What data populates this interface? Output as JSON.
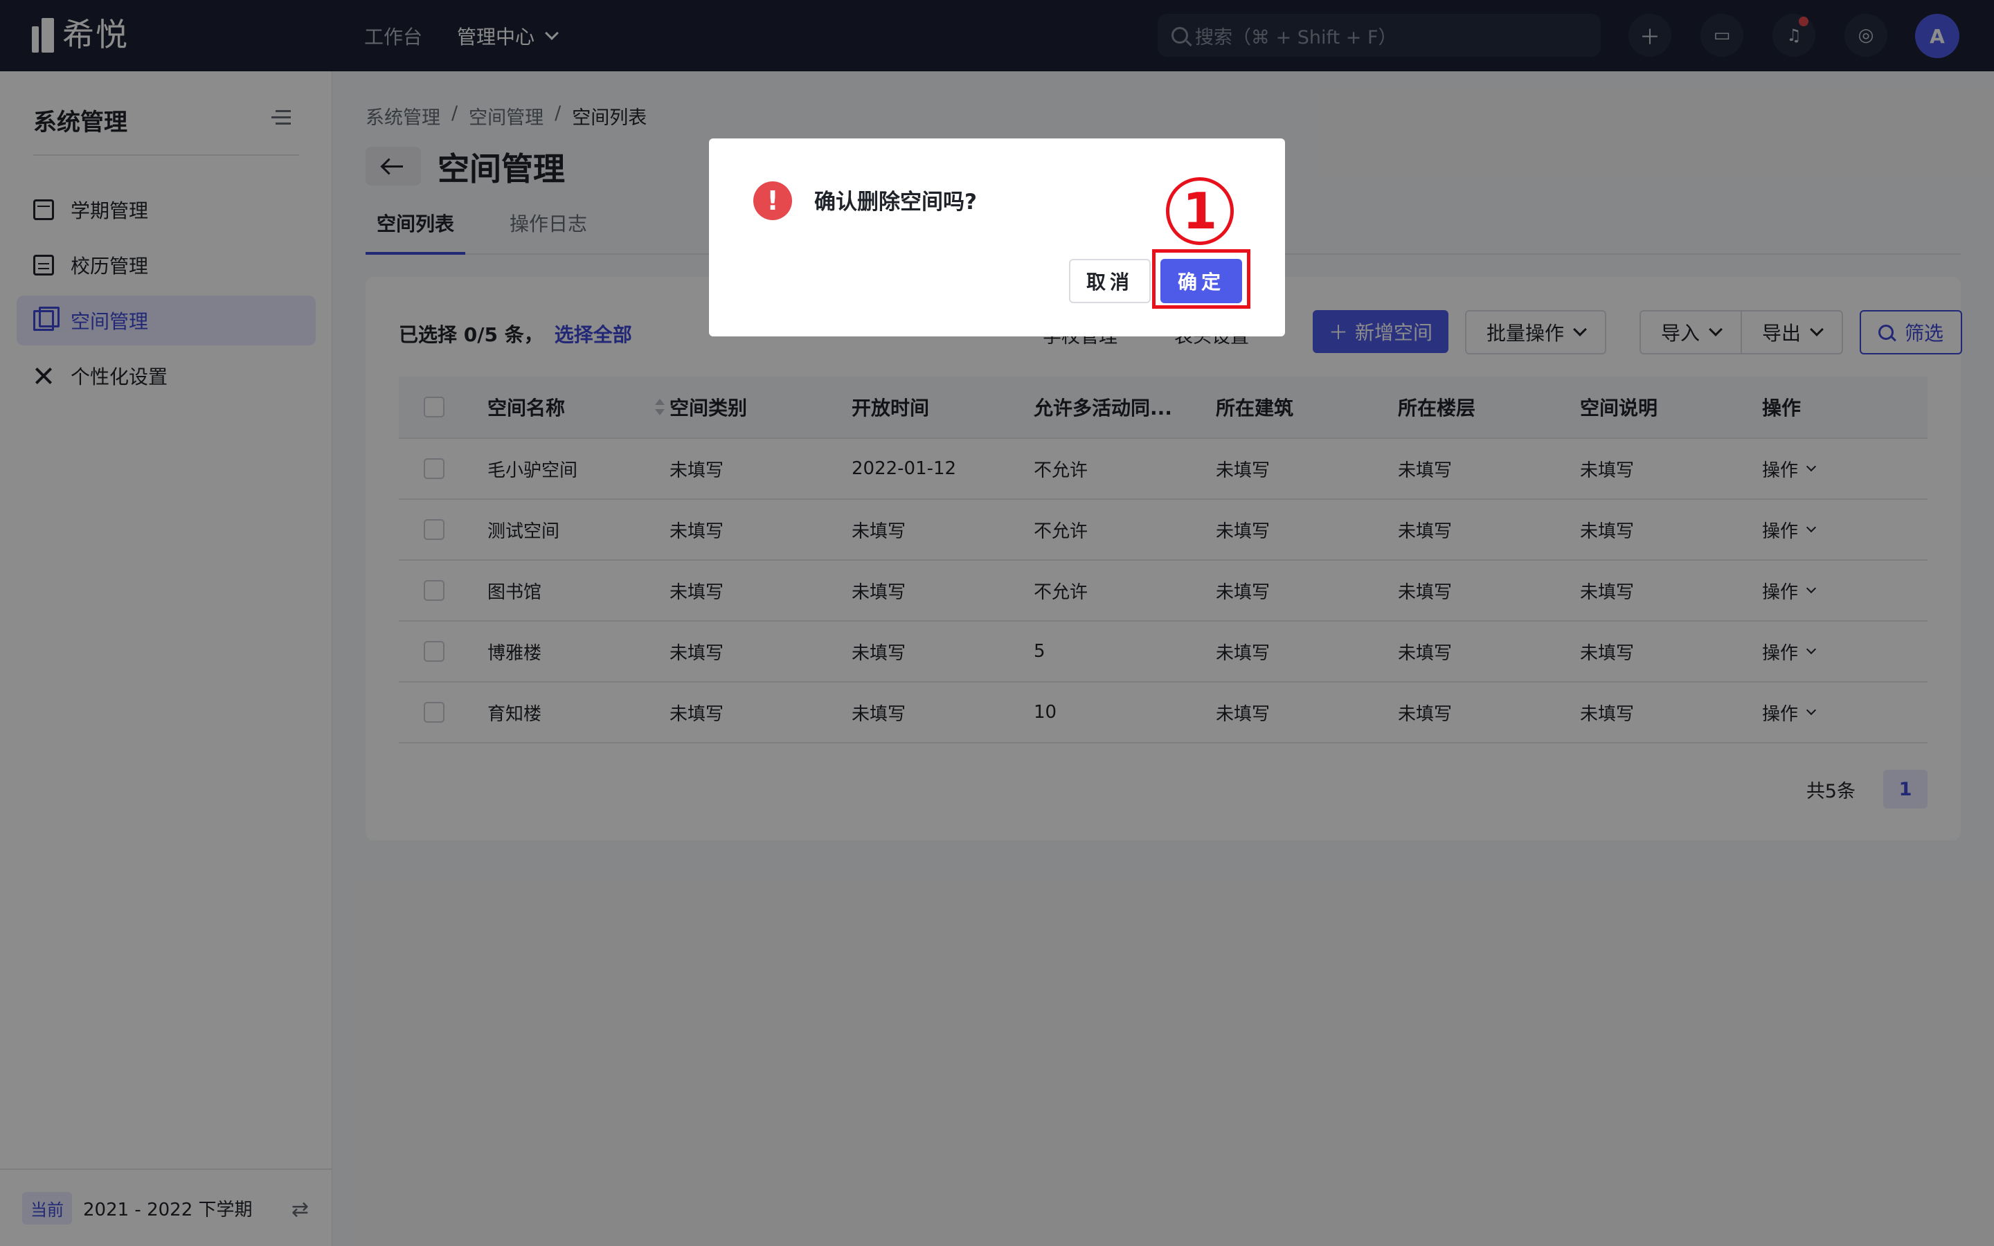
{
  "app": {
    "logo_text": "希悦",
    "topnav": [
      "工作台",
      "管理中心"
    ],
    "search_placeholder": "搜索（⌘ + Shift + F）",
    "avatar_initial": "A"
  },
  "sidebar": {
    "title": "系统管理",
    "items": [
      {
        "label": "学期管理",
        "icon": "calendar-icon"
      },
      {
        "label": "校历管理",
        "icon": "calendar-grid-icon"
      },
      {
        "label": "空间管理",
        "icon": "cube-icon",
        "active": true
      },
      {
        "label": "个性化设置",
        "icon": "tools-icon"
      }
    ],
    "footer_badge": "当前",
    "footer_term": "2021 - 2022 下学期"
  },
  "main": {
    "breadcrumb": [
      "系统管理",
      "/",
      "空间管理",
      "/",
      "空间列表"
    ],
    "title": "空间管理",
    "tabs": [
      "空间列表",
      "操作日志"
    ],
    "selection_text": "已选择 0/5 条，",
    "select_all": "选择全部",
    "toolbar_hidden_1": "学校管理",
    "toolbar_hidden_2": "表头设置",
    "add_button": "新增空间",
    "batch_button": "批量操作",
    "import_button": "导入",
    "export_button": "导出",
    "filter_button": "筛选"
  },
  "table": {
    "columns": [
      "空间名称",
      "空间类别",
      "开放时间",
      "允许多活动同...",
      "所在建筑",
      "所在楼层",
      "空间说明",
      "操作"
    ],
    "rows": [
      [
        "毛小驴空间",
        "未填写",
        "2022-01-12",
        "不允许",
        "未填写",
        "未填写",
        "未填写",
        "操作"
      ],
      [
        "测试空间",
        "未填写",
        "未填写",
        "不允许",
        "未填写",
        "未填写",
        "未填写",
        "操作"
      ],
      [
        "图书馆",
        "未填写",
        "未填写",
        "不允许",
        "未填写",
        "未填写",
        "未填写",
        "操作"
      ],
      [
        "博雅楼",
        "未填写",
        "未填写",
        "5",
        "未填写",
        "未填写",
        "未填写",
        "操作"
      ],
      [
        "育知楼",
        "未填写",
        "未填写",
        "10",
        "未填写",
        "未填写",
        "未填写",
        "操作"
      ]
    ],
    "total": "共5条",
    "page": "1"
  },
  "modal": {
    "title": "确认删除空间吗?",
    "cancel": "取消",
    "ok": "确定",
    "step_marker": "1"
  },
  "colors": {
    "primary": "#4d5be8",
    "topbar": "#1c2233",
    "danger": "#e5484d",
    "annotation": "#e8101a"
  }
}
